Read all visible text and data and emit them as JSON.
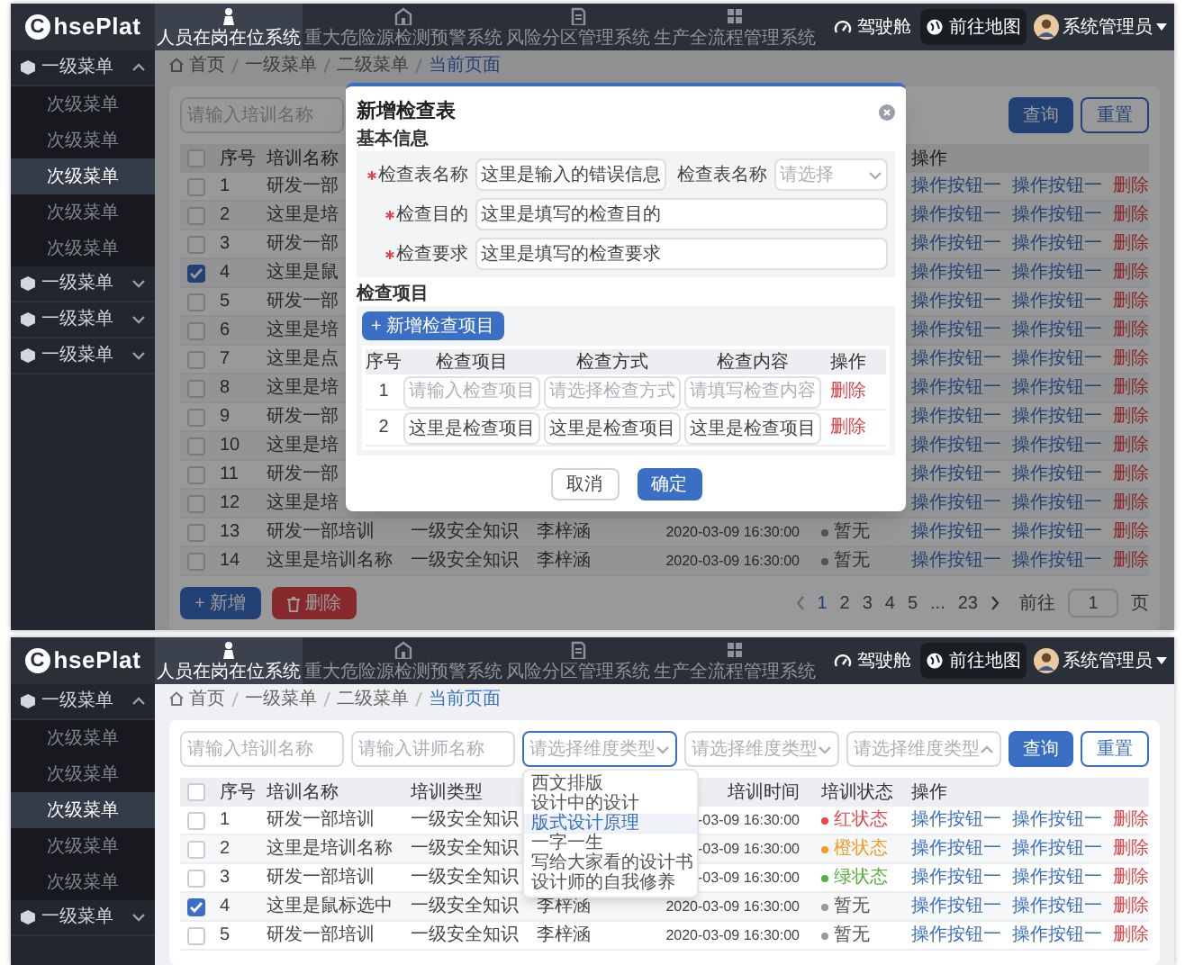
{
  "screens": [
    {
      "header": {
        "logo_mark": "C",
        "logo_text": "hsePlat",
        "tabs": [
          {
            "label": "人员在岗在位系统",
            "selected": true
          },
          {
            "label": "重大危险源检测预警系统",
            "selected": false
          },
          {
            "label": "风险分区管理系统",
            "selected": false
          },
          {
            "label": "生产全流程管理系统",
            "selected": false
          }
        ],
        "links": [
          {
            "label": "驾驶舱",
            "selected": false
          },
          {
            "label": "前往地图",
            "selected": true
          }
        ],
        "user": "系统管理员"
      },
      "sidebar": [
        {
          "label": "一级菜单",
          "expanded": true,
          "children": [
            {
              "label": "次级菜单",
              "selected": false
            },
            {
              "label": "次级菜单",
              "selected": false
            },
            {
              "label": "次级菜单",
              "selected": true
            },
            {
              "label": "次级菜单",
              "selected": false
            },
            {
              "label": "次级菜单",
              "selected": false
            }
          ]
        },
        {
          "label": "一级菜单",
          "expanded": false
        },
        {
          "label": "一级菜单",
          "expanded": false
        },
        {
          "label": "一级菜单",
          "expanded": false
        }
      ],
      "breadcrumb": [
        {
          "label": "首页",
          "selected": false
        },
        {
          "label": "一级菜单",
          "selected": false
        },
        {
          "label": "二级菜单",
          "selected": false
        },
        {
          "label": "当前页面",
          "selected": true
        }
      ],
      "filters": [
        {
          "kind": "input",
          "placeholder": "请输入培训名称"
        }
      ],
      "filter_buttons": [
        {
          "label": "查询",
          "kind": "primary"
        },
        {
          "label": "重置",
          "kind": "outline"
        }
      ],
      "table": {
        "header": {
          "no": "序号",
          "name": "培训名称",
          "actions": "操作"
        },
        "header_checked": false,
        "rows": [
          {
            "checked": false,
            "no": "1",
            "name": "研发一部",
            "actions": [
              {
                "label": "操作按钮一",
                "kind": "link"
              },
              {
                "label": "操作按钮一",
                "kind": "link"
              },
              {
                "label": "删除",
                "kind": "danger"
              }
            ]
          },
          {
            "checked": false,
            "no": "2",
            "name": "这里是培",
            "actions": [
              {
                "label": "操作按钮一",
                "kind": "link"
              },
              {
                "label": "操作按钮一",
                "kind": "link"
              },
              {
                "label": "删除",
                "kind": "danger"
              }
            ]
          },
          {
            "checked": false,
            "no": "3",
            "name": "研发一部",
            "actions": [
              {
                "label": "操作按钮一",
                "kind": "link"
              },
              {
                "label": "操作按钮一",
                "kind": "link"
              },
              {
                "label": "删除",
                "kind": "danger"
              }
            ]
          },
          {
            "checked": true,
            "no": "4",
            "name": "这里是鼠",
            "actions": [
              {
                "label": "操作按钮一",
                "kind": "link"
              },
              {
                "label": "操作按钮一",
                "kind": "link"
              },
              {
                "label": "删除",
                "kind": "danger"
              }
            ]
          },
          {
            "checked": false,
            "no": "5",
            "name": "研发一部",
            "actions": [
              {
                "label": "操作按钮一",
                "kind": "link"
              },
              {
                "label": "操作按钮一",
                "kind": "link"
              },
              {
                "label": "删除",
                "kind": "danger"
              }
            ]
          },
          {
            "checked": false,
            "no": "6",
            "name": "这里是培",
            "actions": [
              {
                "label": "操作按钮一",
                "kind": "link"
              },
              {
                "label": "操作按钮一",
                "kind": "link"
              },
              {
                "label": "删除",
                "kind": "danger"
              }
            ]
          },
          {
            "checked": false,
            "no": "7",
            "name": "这里是点",
            "actions": [
              {
                "label": "操作按钮一",
                "kind": "link"
              },
              {
                "label": "操作按钮一",
                "kind": "link"
              },
              {
                "label": "删除",
                "kind": "danger"
              }
            ]
          },
          {
            "checked": false,
            "no": "8",
            "name": "这里是培",
            "actions": [
              {
                "label": "操作按钮一",
                "kind": "link"
              },
              {
                "label": "操作按钮一",
                "kind": "link"
              },
              {
                "label": "删除",
                "kind": "danger"
              }
            ]
          },
          {
            "checked": false,
            "no": "9",
            "name": "研发一部",
            "actions": [
              {
                "label": "操作按钮一",
                "kind": "link"
              },
              {
                "label": "操作按钮一",
                "kind": "link"
              },
              {
                "label": "删除",
                "kind": "danger"
              }
            ]
          },
          {
            "checked": false,
            "no": "10",
            "name": "这里是培",
            "actions": [
              {
                "label": "操作按钮一",
                "kind": "link"
              },
              {
                "label": "操作按钮一",
                "kind": "link"
              },
              {
                "label": "删除",
                "kind": "danger"
              }
            ]
          },
          {
            "checked": false,
            "no": "11",
            "name": "研发一部",
            "actions": [
              {
                "label": "操作按钮一",
                "kind": "link"
              },
              {
                "label": "操作按钮一",
                "kind": "link"
              },
              {
                "label": "删除",
                "kind": "danger"
              }
            ]
          },
          {
            "checked": false,
            "no": "12",
            "name": "这里是培",
            "actions": [
              {
                "label": "操作按钮一",
                "kind": "link"
              },
              {
                "label": "操作按钮一",
                "kind": "link"
              },
              {
                "label": "删除",
                "kind": "danger"
              }
            ]
          },
          {
            "checked": false,
            "no": "13",
            "name": "研发一部培训",
            "type": "一级安全知识",
            "teacher": "李梓涵",
            "time": "2020-03-09 16:30:00",
            "status": {
              "label": "暂无",
              "color": "#555555"
            },
            "actions": [
              {
                "label": "操作按钮一",
                "kind": "link"
              },
              {
                "label": "操作按钮一",
                "kind": "link"
              },
              {
                "label": "删除",
                "kind": "danger"
              }
            ]
          },
          {
            "checked": false,
            "no": "14",
            "name": "这里是培训名称",
            "type": "一级安全知识",
            "teacher": "李梓涵",
            "time": "2020-03-09 16:30:00",
            "status": {
              "label": "暂无",
              "color": "#555555"
            },
            "actions": [
              {
                "label": "操作按钮一",
                "kind": "link"
              },
              {
                "label": "操作按钮一",
                "kind": "link"
              },
              {
                "label": "删除",
                "kind": "danger"
              }
            ]
          }
        ]
      },
      "footer": {
        "buttons": [
          {
            "label": "+ 新增",
            "kind": "primary"
          },
          {
            "label": "删除",
            "kind": "danger"
          }
        ],
        "pages": [
          {
            "label": "1",
            "selected": true
          },
          {
            "label": "2",
            "selected": false
          },
          {
            "label": "3",
            "selected": false
          },
          {
            "label": "4",
            "selected": false
          },
          {
            "label": "5",
            "selected": false
          },
          {
            "label": "...",
            "selected": false
          },
          {
            "label": "23",
            "selected": false
          }
        ],
        "goto_label": "前往",
        "goto_value": "1",
        "page_unit": "页"
      },
      "modal": {
        "title": "新增检查表",
        "basic_title": "基本信息",
        "field_rows": [
          [
            {
              "label": "检查表名称",
              "required": true,
              "kind": "input",
              "value": "这里是输入的错误信息"
            },
            {
              "label": "检查表名称",
              "required": false,
              "kind": "select",
              "placeholder": "请选择"
            }
          ],
          [
            {
              "label": "检查目的",
              "required": true,
              "kind": "input",
              "value": "这里是填写的检查目的"
            }
          ],
          [
            {
              "label": "检查要求",
              "required": true,
              "kind": "input",
              "value": "这里是填写的检查要求"
            }
          ]
        ],
        "items_title": "检查项目",
        "add_button": "+ 新增检查项目",
        "columns": [
          "序号",
          "检查项目",
          "检查方式",
          "检查内容",
          "操作"
        ],
        "rows": [
          {
            "cells": [
              {
                "kind": "text",
                "text": "1"
              },
              {
                "kind": "input",
                "placeholder": "请输入检查项目"
              },
              {
                "kind": "input",
                "placeholder": "请选择检查方式"
              },
              {
                "kind": "input",
                "placeholder": "请填写检查内容"
              },
              {
                "kind": "link",
                "text": "删除"
              }
            ]
          },
          {
            "cells": [
              {
                "kind": "text",
                "text": "2"
              },
              {
                "kind": "input",
                "value": "这里是检查项目"
              },
              {
                "kind": "input",
                "value": "这里是检查项目"
              },
              {
                "kind": "input",
                "value": "这里是检查项目"
              },
              {
                "kind": "link",
                "text": "删除"
              }
            ]
          }
        ],
        "buttons": [
          {
            "label": "取消",
            "kind": "outline"
          },
          {
            "label": "确定",
            "kind": "primary"
          }
        ]
      }
    },
    {
      "header": {
        "logo_mark": "C",
        "logo_text": "hsePlat",
        "tabs": [
          {
            "label": "人员在岗在位系统",
            "selected": true
          },
          {
            "label": "重大危险源检测预警系统",
            "selected": false
          },
          {
            "label": "风险分区管理系统",
            "selected": false
          },
          {
            "label": "生产全流程管理系统",
            "selected": false
          }
        ],
        "links": [
          {
            "label": "驾驶舱",
            "selected": false
          },
          {
            "label": "前往地图",
            "selected": true
          }
        ],
        "user": "系统管理员"
      },
      "sidebar": [
        {
          "label": "一级菜单",
          "expanded": true,
          "children": [
            {
              "label": "次级菜单",
              "selected": false
            },
            {
              "label": "次级菜单",
              "selected": false
            },
            {
              "label": "次级菜单",
              "selected": true
            },
            {
              "label": "次级菜单",
              "selected": false
            },
            {
              "label": "次级菜单",
              "selected": false
            }
          ]
        },
        {
          "label": "一级菜单",
          "expanded": false
        }
      ],
      "breadcrumb": [
        {
          "label": "首页",
          "selected": false
        },
        {
          "label": "一级菜单",
          "selected": false
        },
        {
          "label": "二级菜单",
          "selected": false
        },
        {
          "label": "当前页面",
          "selected": true
        }
      ],
      "filters": [
        {
          "kind": "input",
          "placeholder": "请输入培训名称"
        },
        {
          "kind": "input",
          "placeholder": "请输入讲师名称"
        },
        {
          "kind": "select",
          "placeholder": "请选择维度类型",
          "focused": true,
          "expanded": false,
          "options": [
            {
              "label": "西文排版",
              "selected": false
            },
            {
              "label": "设计中的设计",
              "selected": false
            },
            {
              "label": "版式设计原理",
              "selected": true
            },
            {
              "label": "一字一生",
              "selected": false
            },
            {
              "label": "写给大家看的设计书",
              "selected": false
            },
            {
              "label": "设计师的自我修养",
              "selected": false
            }
          ]
        },
        {
          "kind": "select",
          "placeholder": "请选择维度类型",
          "focused": false,
          "expanded": false
        },
        {
          "kind": "select",
          "placeholder": "请选择维度类型",
          "focused": false,
          "expanded": true
        }
      ],
      "filter_buttons": [
        {
          "label": "查询",
          "kind": "primary"
        },
        {
          "label": "重置",
          "kind": "outline"
        }
      ],
      "table": {
        "header": {
          "no": "序号",
          "name": "培训名称",
          "type": "培训类型",
          "time": "培训时间",
          "status": "培训状态",
          "actions": "操作"
        },
        "header_checked": false,
        "rows": [
          {
            "checked": false,
            "no": "1",
            "name": "研发一部培训",
            "type": "一级安全知识",
            "time": "-03-09 16:30:00",
            "status": {
              "label": "红状态",
              "color": "#e5484d"
            },
            "actions": [
              {
                "label": "操作按钮一",
                "kind": "link"
              },
              {
                "label": "操作按钮一",
                "kind": "link"
              },
              {
                "label": "删除",
                "kind": "danger"
              }
            ]
          },
          {
            "checked": false,
            "no": "2",
            "name": "这里是培训名称",
            "type": "一级安全知识",
            "time": "-03-09 16:30:00",
            "status": {
              "label": "橙状态",
              "color": "#f59a23"
            },
            "actions": [
              {
                "label": "操作按钮一",
                "kind": "link"
              },
              {
                "label": "操作按钮一",
                "kind": "link"
              },
              {
                "label": "删除",
                "kind": "danger"
              }
            ]
          },
          {
            "checked": false,
            "no": "3",
            "name": "研发一部培训",
            "type": "一级安全知识",
            "time": "-03-09 16:30:00",
            "status": {
              "label": "绿状态",
              "color": "#52b335"
            },
            "actions": [
              {
                "label": "操作按钮一",
                "kind": "link"
              },
              {
                "label": "操作按钮一",
                "kind": "link"
              },
              {
                "label": "删除",
                "kind": "danger"
              }
            ]
          },
          {
            "checked": true,
            "no": "4",
            "name": "这里是鼠标选中",
            "type": "一级安全知识",
            "teacher": "李梓涵",
            "time": "2020-03-09 16:30:00",
            "status": {
              "label": "暂无",
              "color": "#999999"
            },
            "actions": [
              {
                "label": "操作按钮一",
                "kind": "link"
              },
              {
                "label": "操作按钮一",
                "kind": "link"
              },
              {
                "label": "删除",
                "kind": "danger"
              }
            ]
          },
          {
            "checked": false,
            "no": "5",
            "name": "研发一部培训",
            "type": "一级安全知识",
            "teacher": "李梓涵",
            "time": "2020-03-09 16:30:00",
            "status": {
              "label": "暂无",
              "color": "#999999"
            },
            "actions": [
              {
                "label": "操作按钮一",
                "kind": "link"
              },
              {
                "label": "操作按钮一",
                "kind": "link"
              },
              {
                "label": "删除",
                "kind": "danger"
              }
            ]
          }
        ]
      }
    }
  ]
}
